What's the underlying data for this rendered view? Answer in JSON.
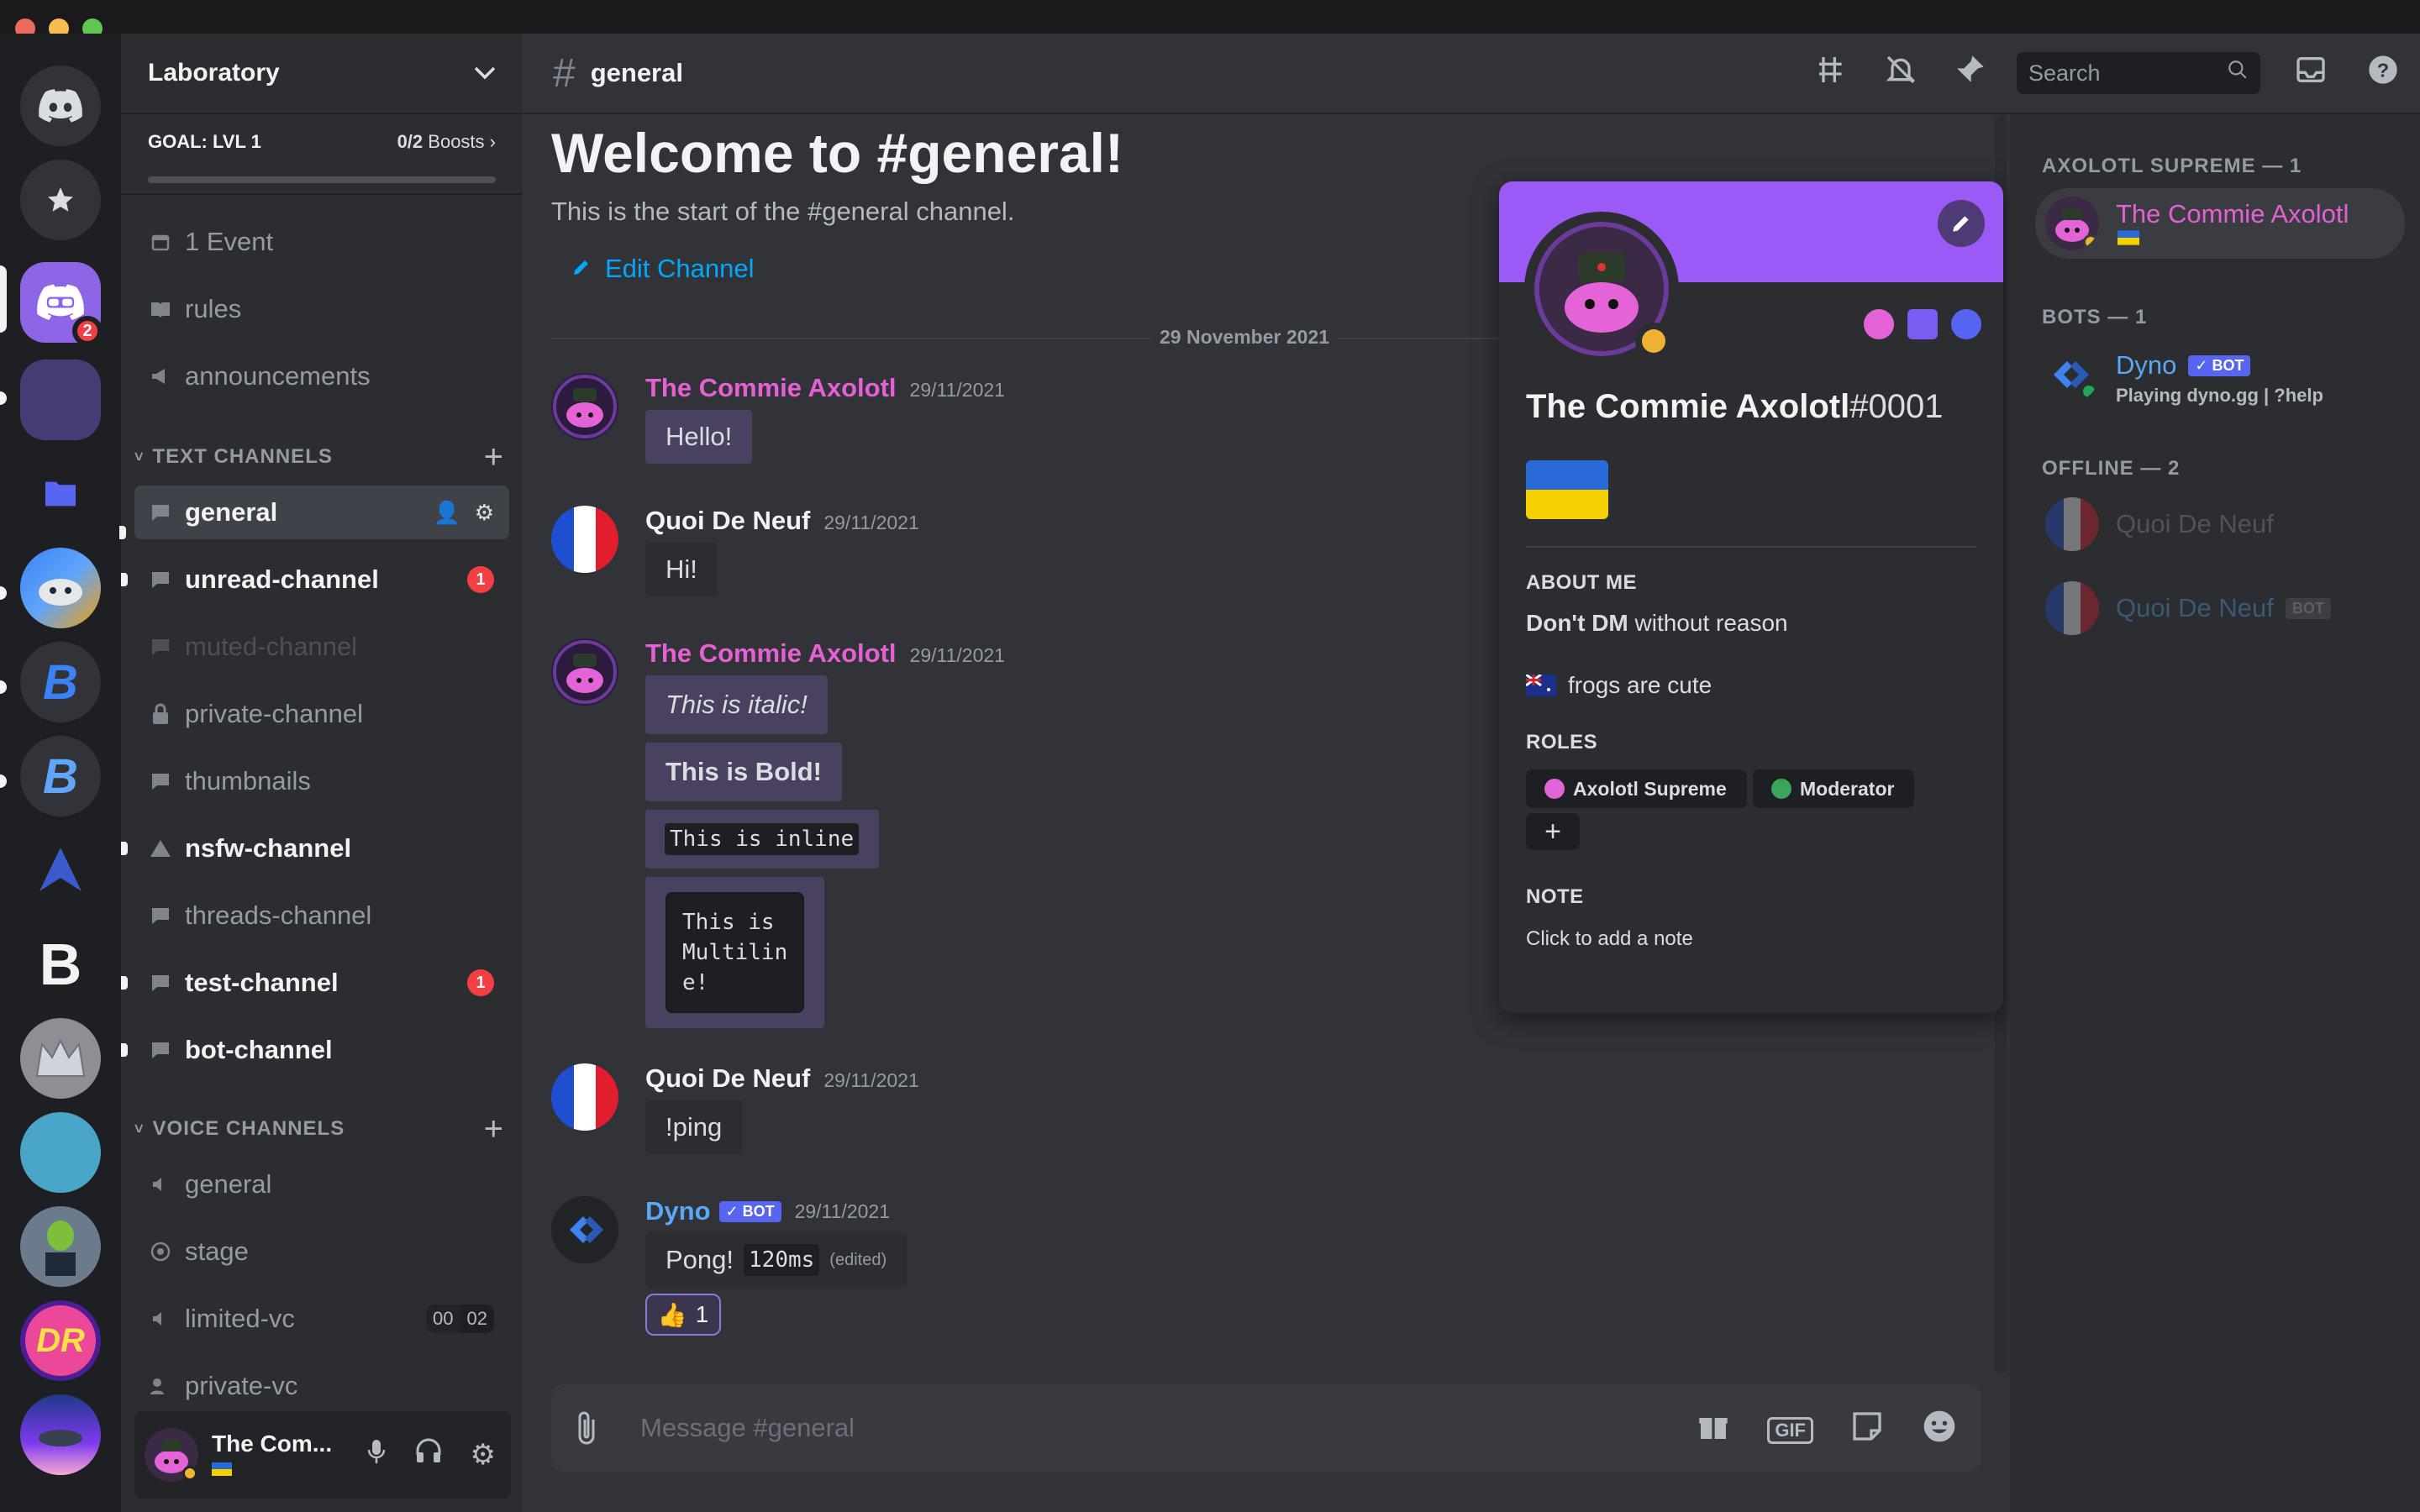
{
  "server": {
    "name": "Laboratory",
    "goal": "GOAL: LVL 1",
    "boosts_count": "0/2",
    "boosts_label": "Boosts",
    "mention_badge": "2"
  },
  "channels": {
    "event": "1 Event",
    "rules": "rules",
    "announcements": "announcements",
    "text_category": "TEXT CHANNELS",
    "voice_category": "VOICE CHANNELS",
    "text": [
      {
        "name": "general"
      },
      {
        "name": "unread-channel",
        "badge": "1"
      },
      {
        "name": "muted-channel"
      },
      {
        "name": "private-channel"
      },
      {
        "name": "thumbnails"
      },
      {
        "name": "nsfw-channel"
      },
      {
        "name": "threads-channel"
      },
      {
        "name": "test-channel",
        "badge": "1"
      },
      {
        "name": "bot-channel"
      }
    ],
    "voice": [
      {
        "name": "general"
      },
      {
        "name": "stage"
      },
      {
        "name": "limited-vc",
        "count_a": "00",
        "count_b": "02"
      },
      {
        "name": "private-vc"
      }
    ]
  },
  "user_panel": {
    "name": "The Com..."
  },
  "header": {
    "channel": "general",
    "search_placeholder": "Search"
  },
  "chat": {
    "welcome_title": "Welcome to #general!",
    "welcome_sub": "This is the start of the #general channel.",
    "edit_channel": "Edit Channel",
    "date_divider": "29 November 2021",
    "messages": [
      {
        "author": "The Commie Axolotl",
        "ts": "29/11/2021",
        "text": "Hello!"
      },
      {
        "author": "Quoi De Neuf",
        "ts": "29/11/2021",
        "text": "Hi!"
      },
      {
        "author": "The Commie Axolotl",
        "ts": "29/11/2021",
        "italic": "This is italic!",
        "bold": "This is Bold!",
        "inline": "This is inline",
        "multiline": "This is\nMultilin\ne!"
      },
      {
        "author": "Quoi De Neuf",
        "ts": "29/11/2021",
        "text": "!ping"
      },
      {
        "author": "Dyno",
        "bot": "✓ BOT",
        "ts": "29/11/2021",
        "text": "Pong!",
        "code": "120ms",
        "edited": "(edited)",
        "reaction_count": "1"
      }
    ],
    "composer_placeholder": "Message #general",
    "gif_label": "GIF"
  },
  "members": {
    "cat_supreme": "AXOLOTL SUPREME — 1",
    "cat_bots": "BOTS — 1",
    "cat_offline": "OFFLINE — 2",
    "supreme_name": "The Commie Axolotl",
    "bot_name": "Dyno",
    "bot_tag": "✓ BOT",
    "bot_status": "Playing dyno.gg | ?help",
    "offline_1": "Quoi De Neuf",
    "offline_2": "Quoi De Neuf",
    "offline_2_tag": "BOT"
  },
  "profile": {
    "name": "The Commie Axolotl",
    "discriminator": "#0001",
    "about_heading": "ABOUT ME",
    "about_bold": "Don't DM",
    "about_rest": " without reason",
    "about_line2": "frogs are cute",
    "roles_heading": "ROLES",
    "roles": [
      {
        "name": "Axolotl Supreme",
        "color": "#e066d8"
      },
      {
        "name": "Moderator",
        "color": "#3ba55c"
      }
    ],
    "note_heading": "NOTE",
    "note_placeholder": "Click to add a note"
  },
  "colors": {
    "axolotl": "#e461d3",
    "dyno": "#5aa8f5",
    "banner": "#9b59f5",
    "mention": "#f23f43"
  }
}
